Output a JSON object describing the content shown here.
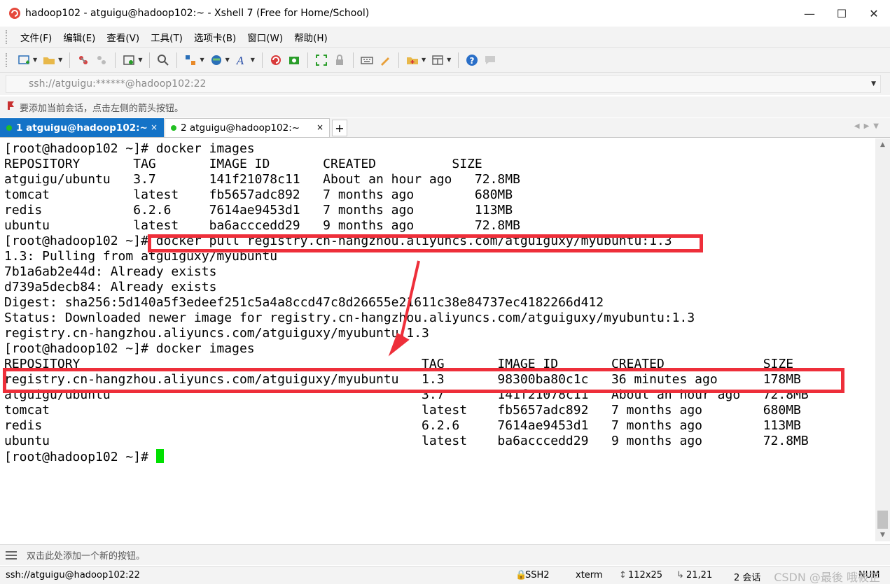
{
  "window": {
    "title": "hadoop102 - atguigu@hadoop102:~ - Xshell 7 (Free for Home/School)",
    "minimize": "—",
    "maximize": "☐",
    "close": "✕"
  },
  "menu": [
    "文件(F)",
    "编辑(E)",
    "查看(V)",
    "工具(T)",
    "选项卡(B)",
    "窗口(W)",
    "帮助(H)"
  ],
  "address": {
    "value": "ssh://atguigu:******@hadoop102:22"
  },
  "hint": "要添加当前会话，点击左侧的箭头按钮。",
  "tabs": [
    {
      "label": "1 atguigu@hadoop102:~",
      "close": "×"
    },
    {
      "label": "2 atguigu@hadoop102:~",
      "close": "×"
    }
  ],
  "tab_add": "+",
  "terminal": {
    "lines": [
      "[root@hadoop102 ~]# docker images",
      "REPOSITORY       TAG       IMAGE ID       CREATED          SIZE",
      "atguigu/ubuntu   3.7       141f21078c11   About an hour ago   72.8MB",
      "tomcat           latest    fb5657adc892   7 months ago        680MB",
      "redis            6.2.6     7614ae9453d1   7 months ago        113MB",
      "ubuntu           latest    ba6acccedd29   9 months ago        72.8MB",
      "[root@hadoop102 ~]# docker pull registry.cn-hangzhou.aliyuncs.com/atguiguxy/myubuntu:1.3",
      "1.3: Pulling from atguiguxy/myubuntu",
      "7b1a6ab2e44d: Already exists",
      "d739a5decb84: Already exists",
      "Digest: sha256:5d140a5f3edeef251c5a4a8ccd47c8d26655e21611c38e84737ec4182266d412",
      "Status: Downloaded newer image for registry.cn-hangzhou.aliyuncs.com/atguiguxy/myubuntu:1.3",
      "registry.cn-hangzhou.aliyuncs.com/atguiguxy/myubuntu:1.3",
      "[root@hadoop102 ~]# docker images",
      "REPOSITORY                                             TAG       IMAGE ID       CREATED             SIZE",
      "registry.cn-hangzhou.aliyuncs.com/atguiguxy/myubuntu   1.3       98300ba80c1c   36 minutes ago      178MB",
      "atguigu/ubuntu                                         3.7       141f21078c11   About an hour ago   72.8MB",
      "tomcat                                                 latest    fb5657adc892   7 months ago        680MB",
      "redis                                                  6.2.6     7614ae9453d1   7 months ago        113MB",
      "ubuntu                                                 latest    ba6acccedd29   9 months ago        72.8MB",
      "[root@hadoop102 ~]# "
    ]
  },
  "quickbar": "双击此处添加一个新的按钮。",
  "status": {
    "connection": "ssh://atguigu@hadoop102:22",
    "protocol": "SSH2",
    "terminal_type": "xterm",
    "size": "112x25",
    "cursor_pos": "21,21",
    "sessions": "2 会话",
    "numlock": "NUM",
    "watermark": "CSDN @最後 哦筱芷"
  },
  "colors": {
    "tab_active": "#1473c7",
    "highlight": "#ee2f3a",
    "cursor": "#00e000"
  }
}
